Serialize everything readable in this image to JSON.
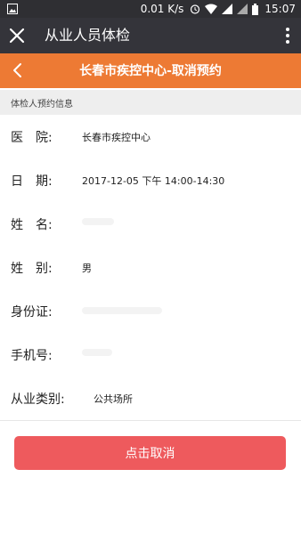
{
  "status_bar": {
    "speed": "0.01 K/s",
    "time": "15:07",
    "icons": [
      "image-icon",
      "alarm-icon",
      "wifi-icon",
      "signal-icon",
      "signal-icon",
      "battery-icon"
    ]
  },
  "app_bar": {
    "title": "从业人员体检",
    "icons": {
      "close": "close-icon",
      "more": "more-vertical-icon"
    }
  },
  "header": {
    "title": "长春市疾控中心-取消预约",
    "background": "#ed7a34"
  },
  "section": {
    "title": "体检人预约信息"
  },
  "fields": [
    {
      "label": "医　院:",
      "value": "长春市疾控中心"
    },
    {
      "label": "日　期:",
      "value": "2017-12-05 下午 14:00-14:30"
    },
    {
      "label": "姓　名:",
      "value": ""
    },
    {
      "label": "姓　别:",
      "value": "男"
    },
    {
      "label": "身份证:",
      "value": ""
    },
    {
      "label": "手机号:",
      "value": ""
    },
    {
      "label": "从业类别:",
      "value": "公共场所"
    }
  ],
  "cancel_button": {
    "label": "点击取消",
    "color": "#ee5a5d"
  }
}
